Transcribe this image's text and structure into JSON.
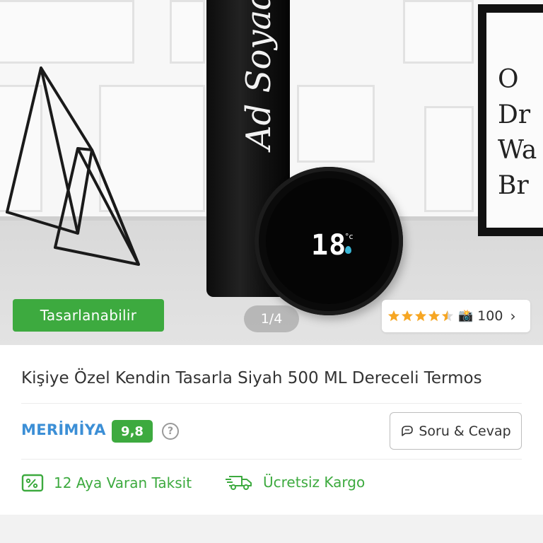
{
  "product_image": {
    "engraving_text": "Ad Soyad",
    "temperature_display": "18",
    "temperature_unit": "°c",
    "frame_text": "O\nDr\nWa\nBr",
    "badge_label": "Tasarlanabilir",
    "pager_text": "1/4",
    "rating": {
      "stars": 4.5,
      "max": 5,
      "photo_review_count": "100"
    }
  },
  "product": {
    "title": "Kişiye Özel Kendin Tasarla Siyah 500 ML Dereceli Termos"
  },
  "seller": {
    "name": "MERİMİYA",
    "score": "9,8",
    "help_icon_text": "?"
  },
  "actions": {
    "qa_label": "Soru & Cevap"
  },
  "features": [
    {
      "label": "12 Aya Varan Taksit",
      "icon": "installment-icon"
    },
    {
      "label": "Ücretsiz Kargo",
      "icon": "truck-icon"
    }
  ],
  "colors": {
    "accent_green": "#3daa3f",
    "brand_blue": "#3c8fd6",
    "star_orange": "#f6a623"
  }
}
